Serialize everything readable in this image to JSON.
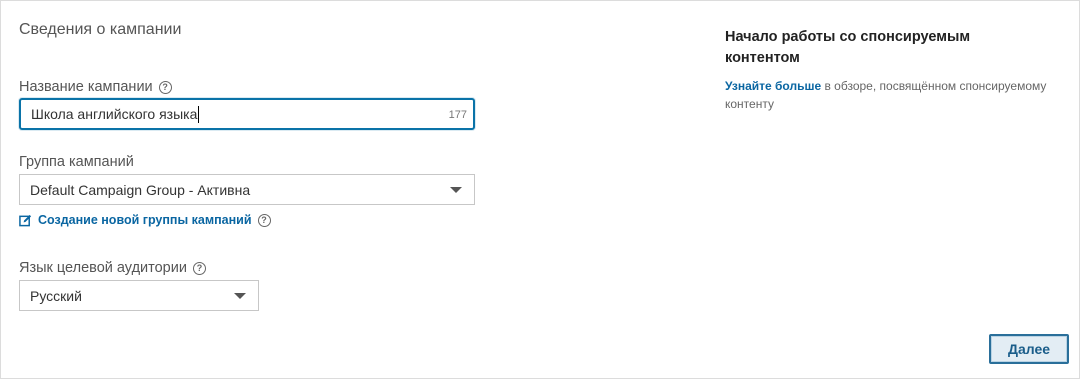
{
  "section": {
    "title": "Сведения о кампании"
  },
  "campaign_name": {
    "label": "Название кампании",
    "value": "Школа английского языка",
    "char_count": "177"
  },
  "campaign_group": {
    "label": "Группа кампаний",
    "selected": "Default Campaign Group - Активна",
    "create_link": "Создание новой группы кампаний"
  },
  "audience_language": {
    "label": "Язык целевой аудитории",
    "selected": "Русский"
  },
  "aside": {
    "title": "Начало работы со спонсируемым контентом",
    "link_text": "Узнайте больше",
    "text": " в обзоре, посвящённом спонсируемому контенту"
  },
  "footer": {
    "next_label": "Далее"
  },
  "colors": {
    "accent": "#0a66a2",
    "focus_border": "#0a73a8"
  }
}
